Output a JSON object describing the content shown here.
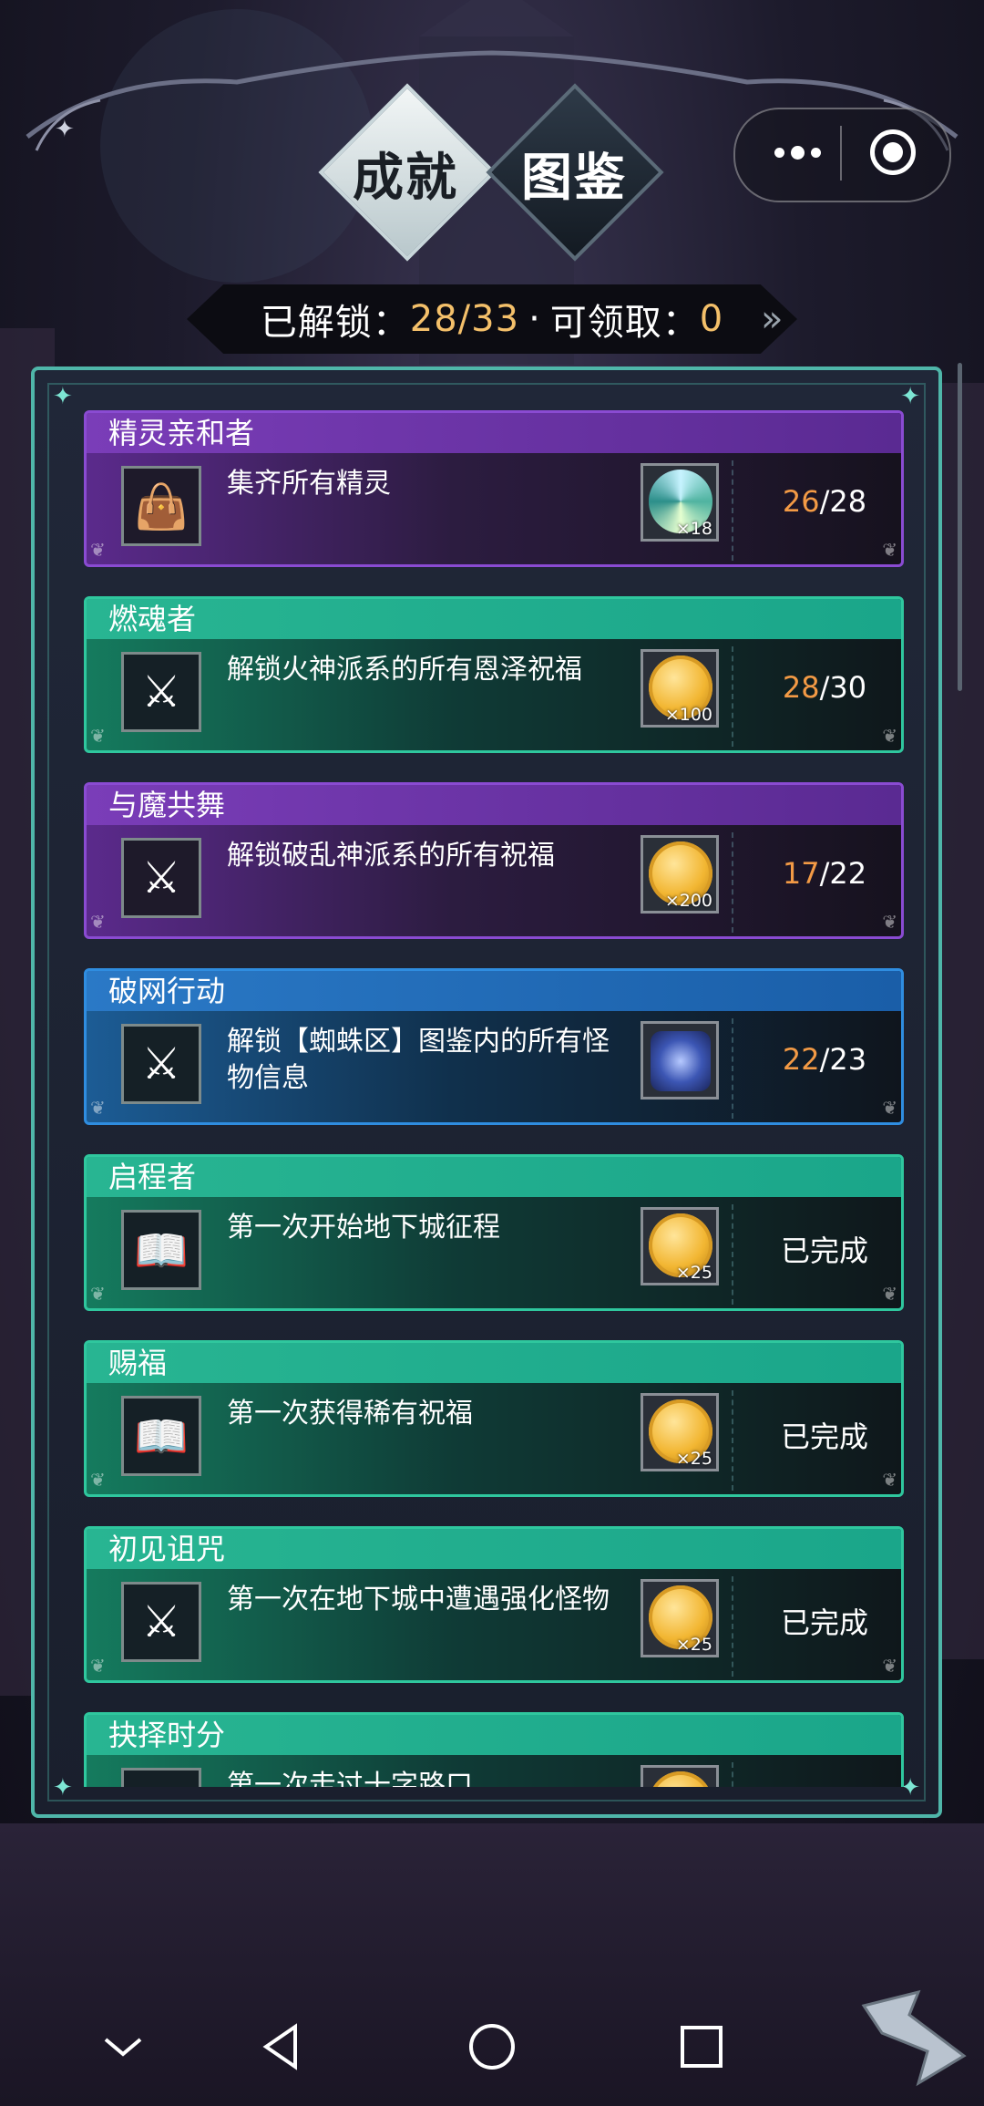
{
  "tabs": {
    "achievements": "成就",
    "gallery": "图鉴"
  },
  "summary": {
    "unlocked_label": "已解锁：",
    "unlocked_current": "28",
    "unlocked_total": "33",
    "separator": "·",
    "claimable_label": "可领取：",
    "claimable_value": "0"
  },
  "achievements": [
    {
      "title": "精灵亲和者",
      "desc": "集齐所有精灵",
      "theme": "purple",
      "icon": "bag-icon",
      "reward": "swirl-gem",
      "reward_qty": "×18",
      "current": "26",
      "total": "28"
    },
    {
      "title": "燃魂者",
      "desc": "解锁火神派系的所有恩泽祝福",
      "theme": "teal",
      "icon": "crossed-swords-icon",
      "reward": "gold-coin",
      "reward_qty": "×100",
      "current": "28",
      "total": "30"
    },
    {
      "title": "与魔共舞",
      "desc": "解锁破乱神派系的所有祝福",
      "theme": "purple",
      "icon": "crossed-swords-icon",
      "reward": "gold-coin",
      "reward_qty": "×200",
      "current": "17",
      "total": "22"
    },
    {
      "title": "破网行动",
      "desc": "解锁【蜘蛛区】图鉴内的所有怪物信息",
      "theme": "blue",
      "icon": "crossed-swords-icon",
      "reward": "blue-gem",
      "reward_qty": "",
      "current": "22",
      "total": "23"
    },
    {
      "title": "启程者",
      "desc": "第一次开始地下城征程",
      "theme": "teal",
      "icon": "book-icon",
      "reward": "gold-coin",
      "reward_qty": "×25",
      "status": "已完成"
    },
    {
      "title": "赐福",
      "desc": "第一次获得稀有祝福",
      "theme": "teal",
      "icon": "book-icon",
      "reward": "gold-coin",
      "reward_qty": "×25",
      "status": "已完成"
    },
    {
      "title": "初见诅咒",
      "desc": "第一次在地下城中遭遇强化怪物",
      "theme": "teal",
      "icon": "crossed-swords-icon",
      "reward": "gold-coin",
      "reward_qty": "×25",
      "status": "已完成"
    },
    {
      "title": "抉择时分",
      "desc": "第一次走过十字路口",
      "theme": "teal",
      "icon": "book-icon",
      "reward": "gold-coin",
      "reward_qty": "",
      "status": ""
    }
  ],
  "colors": {
    "accent_teal": "#4fb6a9",
    "progress_current": "#f39a45",
    "summary_gold": "#f4c06a"
  }
}
